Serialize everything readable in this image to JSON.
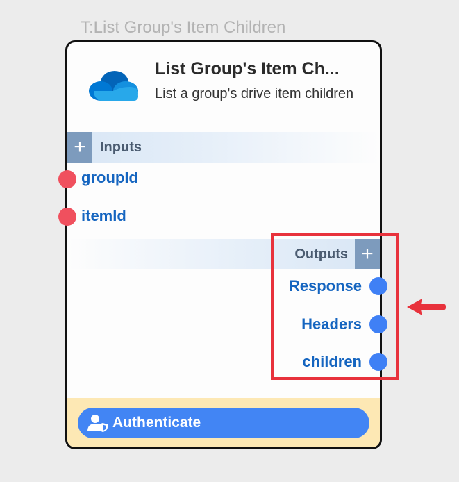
{
  "node": {
    "overlay_title": "T:List Group's Item Children",
    "title": "List Group's Item Ch...",
    "description": "List a group's drive item children",
    "logo_icon": "onedrive-cloud-icon"
  },
  "inputs": {
    "label": "Inputs",
    "add_label": "+",
    "ports": [
      {
        "label": "groupId"
      },
      {
        "label": "itemId"
      }
    ]
  },
  "outputs": {
    "label": "Outputs",
    "add_label": "+",
    "ports": [
      {
        "label": "Response"
      },
      {
        "label": "Headers"
      },
      {
        "label": "children"
      }
    ]
  },
  "footer": {
    "auth_label": "Authenticate",
    "auth_icon": "user-shield-icon"
  },
  "colors": {
    "input_port": "#f0505e",
    "output_port": "#3f80f5",
    "port_label": "#1565c0",
    "highlight": "#e8323c",
    "footer_bg": "#fde8b4",
    "auth_button": "#4285f4"
  }
}
